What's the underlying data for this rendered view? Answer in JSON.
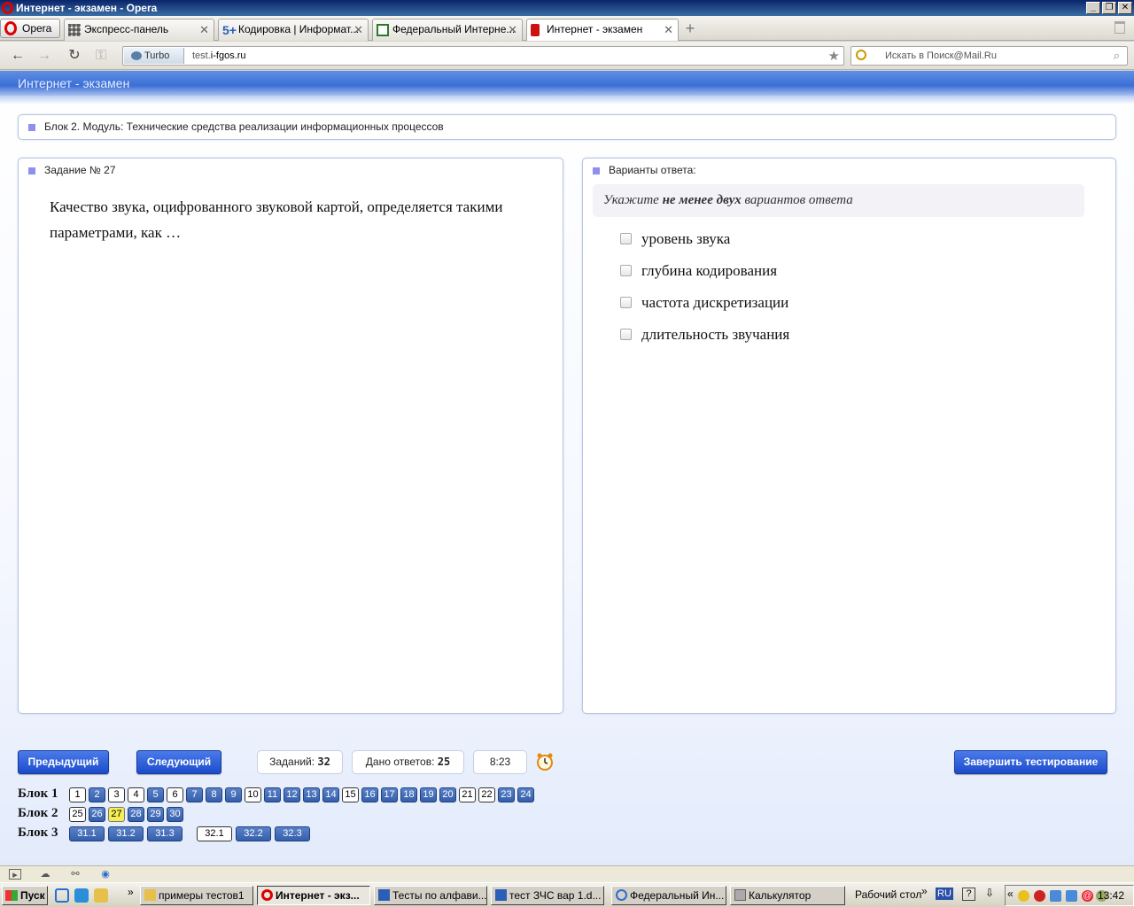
{
  "window": {
    "title": "Интернет - экзамен - Opera",
    "controls": [
      "_",
      "❐",
      "✕"
    ]
  },
  "browser": {
    "menu_label": "Opera",
    "tabs": [
      {
        "label": "Экспресс-панель",
        "icon": "grid-icon"
      },
      {
        "label": "Кодировка | Информат...",
        "icon": "plus-icon"
      },
      {
        "label": "Федеральный Интерне...",
        "icon": "network-icon"
      },
      {
        "label": "Интернет - экзамен",
        "icon": "exam-icon",
        "active": true
      }
    ],
    "new_tab": "+",
    "turbo_label": "Turbo",
    "url_prefix": "test.",
    "url_domain": "i-fgos.ru",
    "search_placeholder": "Искать в Поиск@Mail.Ru"
  },
  "app": {
    "header_title": "Интернет - экзамен",
    "block_title": "Блок 2. Модуль: Технические средства реализации информационных процессов",
    "task_label": "Задание № 27",
    "question": "Качество звука, оцифрованного звуковой картой, определяется такими параметрами, как …",
    "answers_label": "Варианты ответа:",
    "hint_pre": "Укажите ",
    "hint_bold": "не менее двух",
    "hint_post": " вариантов ответа",
    "options": [
      {
        "label": "уровень звука",
        "checked": false
      },
      {
        "label": "глубина кодирования",
        "checked": false
      },
      {
        "label": "частота дискретизации",
        "checked": false
      },
      {
        "label": "длительность звучания",
        "checked": false
      }
    ]
  },
  "controls": {
    "prev": "Предыдущий",
    "next": "Следующий",
    "tasks_label": "Заданий:",
    "tasks_value": "32",
    "answered_label": "Дано ответов:",
    "answered_value": "25",
    "time": "8:23",
    "finish": "Завершить тестирование"
  },
  "blocks": [
    {
      "label": "Блок 1",
      "items": [
        {
          "n": "1",
          "s": "done"
        },
        {
          "n": "2",
          "s": "todo"
        },
        {
          "n": "3",
          "s": "done"
        },
        {
          "n": "4",
          "s": "done"
        },
        {
          "n": "5",
          "s": "todo"
        },
        {
          "n": "6",
          "s": "done"
        },
        {
          "n": "7",
          "s": "todo"
        },
        {
          "n": "8",
          "s": "todo"
        },
        {
          "n": "9",
          "s": "todo"
        },
        {
          "n": "10",
          "s": "done"
        },
        {
          "n": "11",
          "s": "todo"
        },
        {
          "n": "12",
          "s": "todo"
        },
        {
          "n": "13",
          "s": "todo"
        },
        {
          "n": "14",
          "s": "todo"
        },
        {
          "n": "15",
          "s": "done"
        },
        {
          "n": "16",
          "s": "todo"
        },
        {
          "n": "17",
          "s": "todo"
        },
        {
          "n": "18",
          "s": "todo"
        },
        {
          "n": "19",
          "s": "todo"
        },
        {
          "n": "20",
          "s": "todo"
        },
        {
          "n": "21",
          "s": "done"
        },
        {
          "n": "22",
          "s": "done"
        },
        {
          "n": "23",
          "s": "todo"
        },
        {
          "n": "24",
          "s": "todo"
        }
      ]
    },
    {
      "label": "Блок 2",
      "items": [
        {
          "n": "25",
          "s": "done"
        },
        {
          "n": "26",
          "s": "todo"
        },
        {
          "n": "27",
          "s": "cur"
        },
        {
          "n": "28",
          "s": "todo"
        },
        {
          "n": "29",
          "s": "todo"
        },
        {
          "n": "30",
          "s": "todo"
        }
      ]
    },
    {
      "label": "Блок 3",
      "items": [
        {
          "n": "31.1",
          "s": "todo"
        },
        {
          "n": "31.2",
          "s": "todo"
        },
        {
          "n": "31.3",
          "s": "todo"
        },
        {
          "n": "32.1",
          "s": "done",
          "gap": true
        },
        {
          "n": "32.2",
          "s": "todo"
        },
        {
          "n": "32.3",
          "s": "todo"
        }
      ]
    }
  ],
  "taskbar": {
    "start": "Пуск",
    "tasks": [
      {
        "label": "примеры тестов1",
        "icon": "folder-icon"
      },
      {
        "label": "Интернет - экз...",
        "icon": "opera-icon",
        "active": true
      },
      {
        "label": "Тесты по алфави...",
        "icon": "word-icon"
      },
      {
        "label": "тест ЗЧС вар 1.d...",
        "icon": "word-icon"
      },
      {
        "label": "Федеральный Ин...",
        "icon": "ie-icon"
      },
      {
        "label": "Калькулятор",
        "icon": "calculator-icon"
      }
    ],
    "desktop_label": "Рабочий стол",
    "lang": "RU",
    "clock": "13:42"
  }
}
